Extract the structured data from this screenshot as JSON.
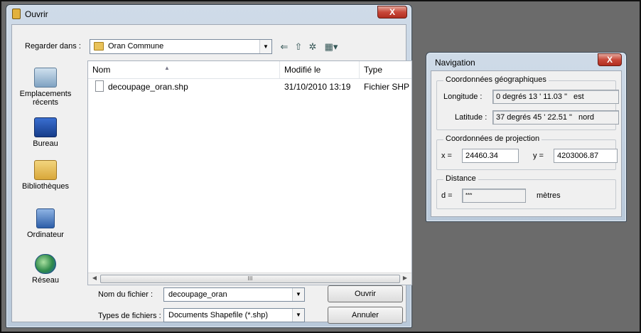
{
  "ouvrir": {
    "title": "Ouvrir",
    "close_label": "X",
    "look_in_label": "Regarder dans :",
    "look_in_value": "Oran Commune",
    "places": [
      {
        "label": "Emplacements récents"
      },
      {
        "label": "Bureau"
      },
      {
        "label": "Bibliothèques"
      },
      {
        "label": "Ordinateur"
      },
      {
        "label": "Réseau"
      }
    ],
    "columns": [
      "Nom",
      "Modifié le",
      "Type"
    ],
    "files": [
      {
        "name": "decoupage_oran.shp",
        "modified": "31/10/2010 13:19",
        "type": "Fichier SHP"
      }
    ],
    "scroll_thumb": "III",
    "filename_label": "Nom du fichier :",
    "filename_value": "decoupage_oran",
    "filetype_label": "Types de fichiers :",
    "filetype_value": "Documents Shapefile (*.shp)",
    "open_button": "Ouvrir",
    "cancel_button": "Annuler"
  },
  "navigation": {
    "title": "Navigation",
    "close_label": "X",
    "geo": {
      "title": "Coordonnées géographiques",
      "longitude_label": "Longitude :",
      "longitude_value": "0 degrés 13 ' 11.03 \"",
      "longitude_dir": "est",
      "latitude_label": "Latitude :",
      "latitude_value": "37 degrés 45 ' 22.51 \"",
      "latitude_dir": "nord"
    },
    "proj": {
      "title": "Coordonnées de projection",
      "x_label": "x =",
      "x_value": "24460.34",
      "y_label": "y =",
      "y_value": "4203006.87"
    },
    "distance": {
      "title": "Distance",
      "d_label": "d =",
      "d_value": "***",
      "unit": "mètres"
    }
  }
}
